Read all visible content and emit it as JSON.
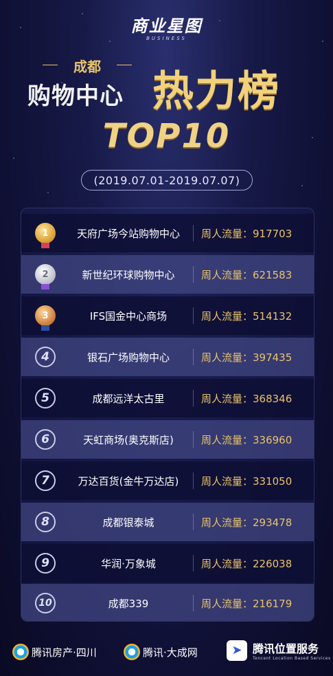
{
  "header": {
    "logo_text": "商业星图",
    "logo_sub": "BUSINESS",
    "city": "成都",
    "title_left": "购物中心",
    "title_right": "热力榜",
    "top_label": "TOP10",
    "date_range": "(2019.07.01-2019.07.07)"
  },
  "table": {
    "rows": [
      {
        "rank": "1",
        "name": "天府广场今站购物中心",
        "flow": "周人流量：917703"
      },
      {
        "rank": "2",
        "name": "新世纪环球购物中心",
        "flow": "周人流量：621583"
      },
      {
        "rank": "3",
        "name": "IFS国金中心商场",
        "flow": "周人流量：514132"
      },
      {
        "rank": "4",
        "name": "银石广场购物中心",
        "flow": "周人流量：397435"
      },
      {
        "rank": "5",
        "name": "成都远洋太古里",
        "flow": "周人流量：368346"
      },
      {
        "rank": "6",
        "name": "天虹商场(奥克斯店)",
        "flow": "周人流量：336960"
      },
      {
        "rank": "7",
        "name": "万达百货(金牛万达店)",
        "flow": "周人流量：331050"
      },
      {
        "rank": "8",
        "name": "成都银泰城",
        "flow": "周人流量：293478"
      },
      {
        "rank": "9",
        "name": "华润·万象城",
        "flow": "周人流量：226038"
      },
      {
        "rank": "10",
        "name": "成都339",
        "flow": "周人流量：216179"
      }
    ]
  },
  "footer": {
    "brand1": "腾讯房产·四川",
    "brand2": "腾讯·大成网",
    "brand3_title": "腾讯位置服务",
    "brand3_sub": "Tencent Location Based Services"
  },
  "colors": {
    "gold": "#e9c36a",
    "background": "#171a48"
  }
}
